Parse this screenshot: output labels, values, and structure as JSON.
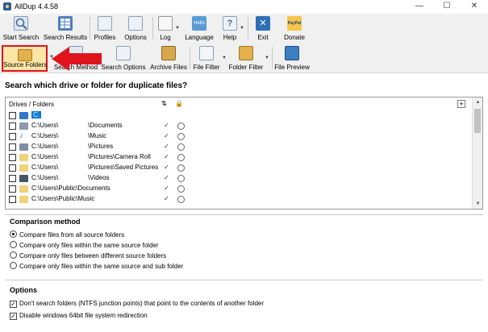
{
  "window": {
    "title": "AllDup 4.4.58",
    "controls": [
      "—",
      "☐",
      "✕"
    ]
  },
  "toolbar_main": [
    {
      "label": "Start Search",
      "icon": "magnifier-icon",
      "color": "#6e8fb8"
    },
    {
      "label": "Search Results",
      "icon": "results-grid-icon",
      "color": "#4f7fbf"
    },
    {
      "label": "Profiles",
      "icon": "profiles-icon",
      "color": "#7a9cc6"
    },
    {
      "label": "Options",
      "icon": "options-icon",
      "color": "#8aa6c8"
    },
    {
      "label": "Log",
      "icon": "log-icon",
      "color": "#9aa8b8"
    },
    {
      "label": "Language",
      "icon": "language-icon",
      "color": "#5b9bd5"
    },
    {
      "label": "Help",
      "icon": "help-icon",
      "color": "#8fa9c9"
    },
    {
      "label": "Exit",
      "icon": "exit-icon",
      "color": "#2f6fb5"
    },
    {
      "label": "Donate",
      "icon": "paypal-icon",
      "color": "#f3c54a"
    }
  ],
  "toolbar_search": [
    {
      "label": "Source Folders",
      "icon": "source-folders-icon",
      "color": "#e3b04b"
    },
    {
      "label": "Search Method",
      "icon": "search-method-icon",
      "color": "#6e8fb8"
    },
    {
      "label": "Search Options",
      "icon": "search-options-icon",
      "color": "#7a9cc6"
    },
    {
      "label": "Archive Files",
      "icon": "archive-files-icon",
      "color": "#d6a84a"
    },
    {
      "label": "File Filter",
      "icon": "file-filter-icon",
      "color": "#a9b7c6"
    },
    {
      "label": "Folder Filter",
      "icon": "folder-filter-icon",
      "color": "#e3b04b"
    },
    {
      "label": "File Preview",
      "icon": "file-preview-icon",
      "color": "#3e7fc1"
    }
  ],
  "main": {
    "heading": "Search which drive or folder for duplicate files?",
    "tree": {
      "column_header": "Drives / Folders",
      "rows": [
        {
          "path": "C:",
          "suffix": "",
          "icon_color": "#2f78c8",
          "selected": true
        },
        {
          "path": "C:\\Users\\",
          "suffix": "\\Documents",
          "icon_color": "#8a99ad",
          "selected": false
        },
        {
          "path": "C:\\Users\\",
          "suffix": "\\Music",
          "icon_color": "#3f7fd0",
          "selected": false
        },
        {
          "path": "C:\\Users\\",
          "suffix": "\\Pictures",
          "icon_color": "#7f8da3",
          "selected": false
        },
        {
          "path": "C:\\Users\\",
          "suffix": "\\Pictures\\Camera Roll",
          "icon_color": "#f2d27a",
          "selected": false
        },
        {
          "path": "C:\\Users\\",
          "suffix": "\\Pictures\\Saved Pictures",
          "icon_color": "#f2d27a",
          "selected": false
        },
        {
          "path": "C:\\Users\\",
          "suffix": "\\Videos",
          "icon_color": "#4a5564",
          "selected": false
        },
        {
          "path": "C:\\Users\\Public\\Documents",
          "suffix": "",
          "icon_color": "#f2d27a",
          "selected": false
        },
        {
          "path": "C:\\Users\\Public\\Music",
          "suffix": "",
          "icon_color": "#f2d27a",
          "selected": false
        }
      ]
    },
    "comparison": {
      "title": "Comparison method",
      "options": [
        {
          "label": "Compare files from all source folders",
          "checked": true
        },
        {
          "label": "Compare only files within the same source folder",
          "checked": false
        },
        {
          "label": "Compare only files between different source folders",
          "checked": false
        },
        {
          "label": "Compare only files within the same source and sub folder",
          "checked": false
        }
      ]
    },
    "options": {
      "title": "Options",
      "items": [
        {
          "label": "Don't search folders (NTFS junction points) that point to the contents of another folder",
          "checked": true
        },
        {
          "label": "Disable windows 64bit file system redirection",
          "checked": true
        }
      ]
    }
  },
  "colors": {
    "highlight_border": "#e0141e",
    "arrow": "#e0141e",
    "selection": "#0078d7"
  }
}
